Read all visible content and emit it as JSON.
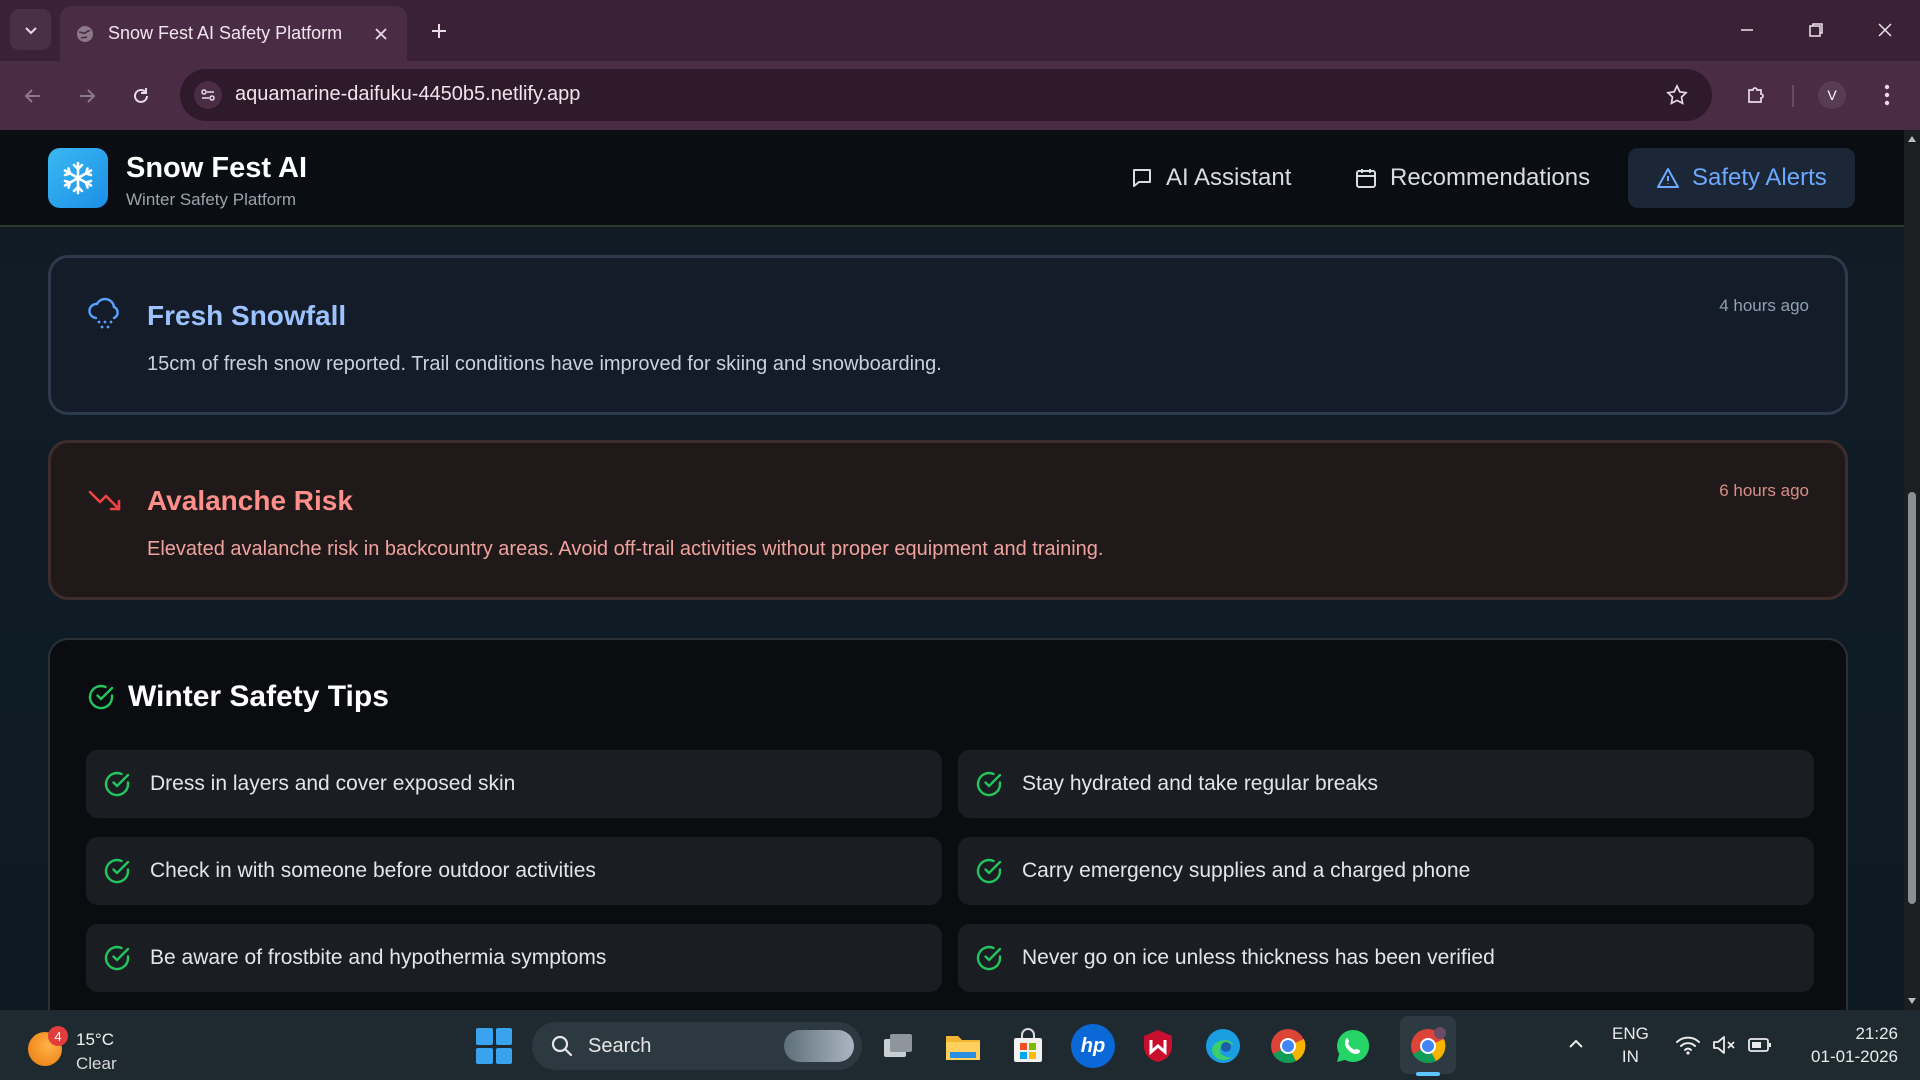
{
  "browser": {
    "tab_title": "Snow Fest AI Safety Platform",
    "url": "aquamarine-daifuku-4450b5.netlify.app",
    "profile_initial": "V"
  },
  "app": {
    "brand_title": "Snow Fest AI",
    "brand_subtitle": "Winter Safety Platform",
    "nav": [
      {
        "label": "AI Assistant",
        "icon": "chat-icon",
        "active": false
      },
      {
        "label": "Recommendations",
        "icon": "calendar-icon",
        "active": false
      },
      {
        "label": "Safety Alerts",
        "icon": "warning-icon",
        "active": true
      }
    ]
  },
  "alerts": [
    {
      "title": "Fresh Snowfall",
      "message": "15cm of fresh snow reported. Trail conditions have improved for skiing and snowboarding.",
      "time": "4 hours ago",
      "icon": "cloud-snow-icon",
      "level": "info"
    },
    {
      "title": "Avalanche Risk",
      "message": "Elevated avalanche risk in backcountry areas. Avoid off-trail activities without proper equipment and training.",
      "time": "6 hours ago",
      "icon": "trending-down-icon",
      "level": "danger"
    }
  ],
  "tips": {
    "title": "Winter Safety Tips",
    "items": [
      "Dress in layers and cover exposed skin",
      "Stay hydrated and take regular breaks",
      "Check in with someone before outdoor activities",
      "Carry emergency supplies and a charged phone",
      "Be aware of frostbite and hypothermia symptoms",
      "Never go on ice unless thickness has been verified"
    ]
  },
  "taskbar": {
    "weather_badge": "4",
    "weather_temp": "15°C",
    "weather_condition": "Clear",
    "search_label": "Search",
    "hp_label": "hp",
    "lang_top": "ENG",
    "lang_bottom": "IN",
    "time": "21:26",
    "date": "01-01-2026"
  },
  "colors": {
    "accent": "#6da9ff",
    "danger": "#ff8f8a",
    "success": "#22c55e",
    "logo": "#2aa5ee"
  }
}
